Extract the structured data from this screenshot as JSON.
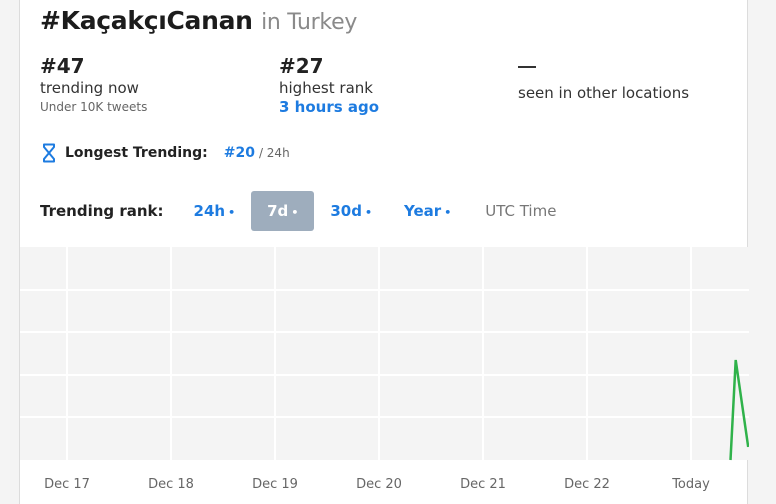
{
  "header": {
    "hashtag": "#KaçakçıCanan",
    "location": "in Turkey"
  },
  "stats": {
    "current": {
      "value": "#47",
      "label": "trending now",
      "sub": "Under 10K tweets"
    },
    "highest": {
      "value": "#27",
      "label": "highest rank",
      "time": "3 hours ago"
    },
    "other": {
      "value": "—",
      "label": "seen in other locations"
    }
  },
  "longest": {
    "icon": "hourglass-icon",
    "label": "Longest Trending:",
    "rank": "#20",
    "period": "/ 24h"
  },
  "range": {
    "label": "Trending rank:",
    "options": [
      {
        "label": "24h",
        "dot": "•",
        "active": false
      },
      {
        "label": "7d",
        "dot": "•",
        "active": true
      },
      {
        "label": "30d",
        "dot": "•",
        "active": false
      },
      {
        "label": "Year",
        "dot": "•",
        "active": false
      }
    ],
    "timezone": "UTC Time"
  },
  "colors": {
    "accent": "#1d7be0",
    "line": "#2fb24a",
    "active_bg": "#9eadbd",
    "plot_bg": "#f4f4f4"
  },
  "chart_data": {
    "type": "line",
    "title": "",
    "xlabel": "",
    "ylabel": "",
    "x_ticks": [
      "Dec 17",
      "Dec 18",
      "Dec 19",
      "Dec 20",
      "Dec 21",
      "Dec 22",
      "Today"
    ],
    "y_axis": "rank (inverted, 1 at top)",
    "ylim": [
      1,
      50
    ],
    "grid": true,
    "series": [
      {
        "name": "Trending rank",
        "x": [
          6.38,
          6.43,
          6.55
        ],
        "values": [
          50,
          27,
          47
        ]
      }
    ]
  }
}
